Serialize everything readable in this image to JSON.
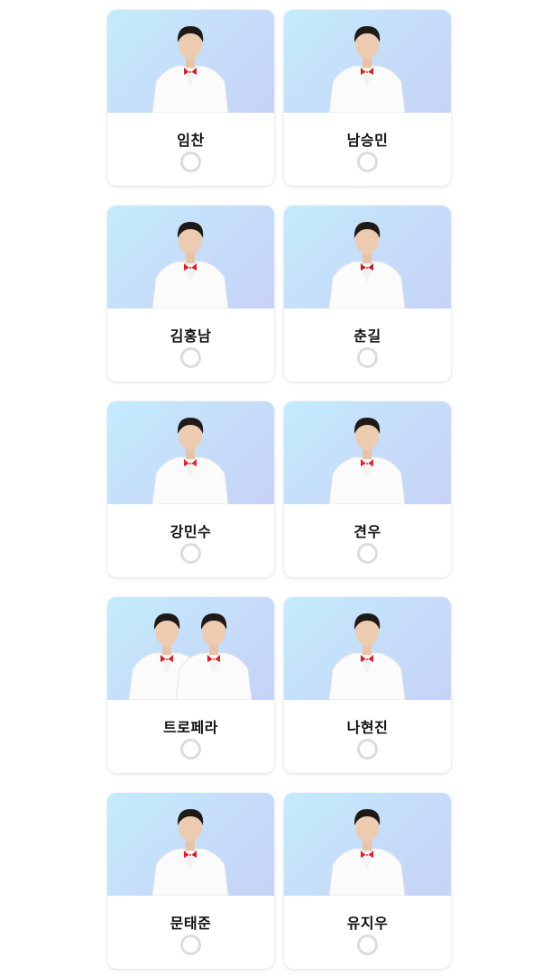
{
  "candidates": [
    {
      "name": "임찬",
      "people": 1,
      "accent": "#c9262d"
    },
    {
      "name": "남승민",
      "people": 1,
      "accent": "#c9262d"
    },
    {
      "name": "김홍남",
      "people": 1,
      "accent": "#d81e2b"
    },
    {
      "name": "춘길",
      "people": 1,
      "accent": "#b71c26"
    },
    {
      "name": "강민수",
      "people": 1,
      "accent": "#e0242b"
    },
    {
      "name": "견우",
      "people": 1,
      "accent": "#d7262c"
    },
    {
      "name": "트로페라",
      "people": 2,
      "accent": "#d41f29"
    },
    {
      "name": "나현진",
      "people": 1,
      "accent": "#d0232b"
    },
    {
      "name": "문태준",
      "people": 1,
      "accent": "#d41f29"
    },
    {
      "name": "유지우",
      "people": 1,
      "accent": "#d8232c"
    }
  ]
}
